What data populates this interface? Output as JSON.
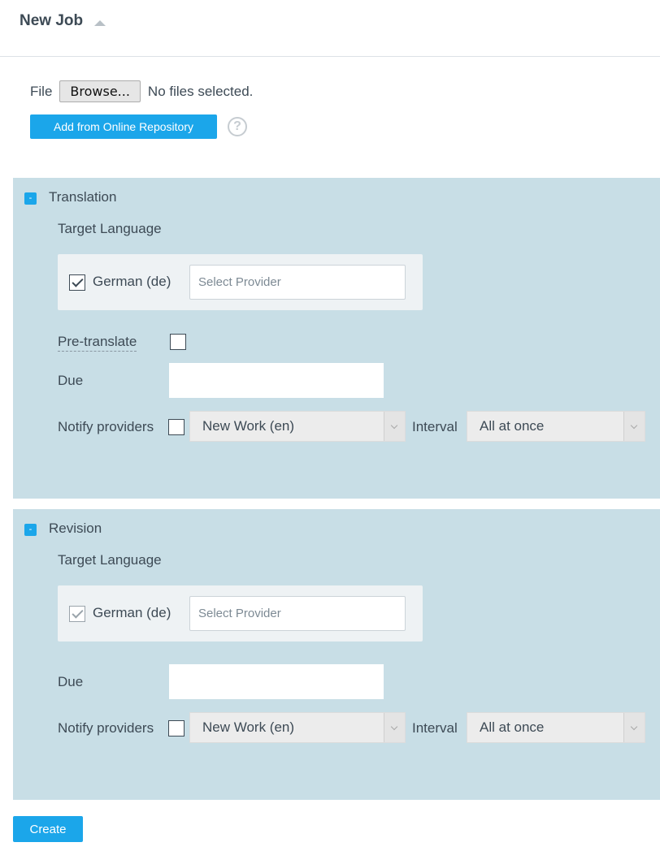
{
  "header": {
    "title": "New Job"
  },
  "file": {
    "label": "File",
    "browse_label": "Browse...",
    "status": "No files selected.",
    "repo_button": "Add from Online Repository",
    "help_symbol": "?"
  },
  "sections": [
    {
      "toggle": "-",
      "title": "Translation",
      "target_language_label": "Target Language",
      "language": {
        "name": "German (de)",
        "checked": true,
        "provider_placeholder": "Select Provider"
      },
      "pretranslate_label": "Pre-translate",
      "due_label": "Due",
      "notify_label": "Notify providers",
      "notify_template": "New Work (en)",
      "interval_label": "Interval",
      "interval_value": "All at once"
    },
    {
      "toggle": "-",
      "title": "Revision",
      "target_language_label": "Target Language",
      "language": {
        "name": "German (de)",
        "checked": true,
        "provider_placeholder": "Select Provider"
      },
      "due_label": "Due",
      "notify_label": "Notify providers",
      "notify_template": "New Work (en)",
      "interval_label": "Interval",
      "interval_value": "All at once"
    }
  ],
  "create_button": "Create",
  "colors": {
    "accent": "#1ba6ea",
    "section_bg": "#c8dee6",
    "text": "#3d4a55"
  },
  "icons": [
    "caret-up-icon",
    "help-icon",
    "collapse-icon",
    "checkmark-icon",
    "chevron-down-icon"
  ]
}
